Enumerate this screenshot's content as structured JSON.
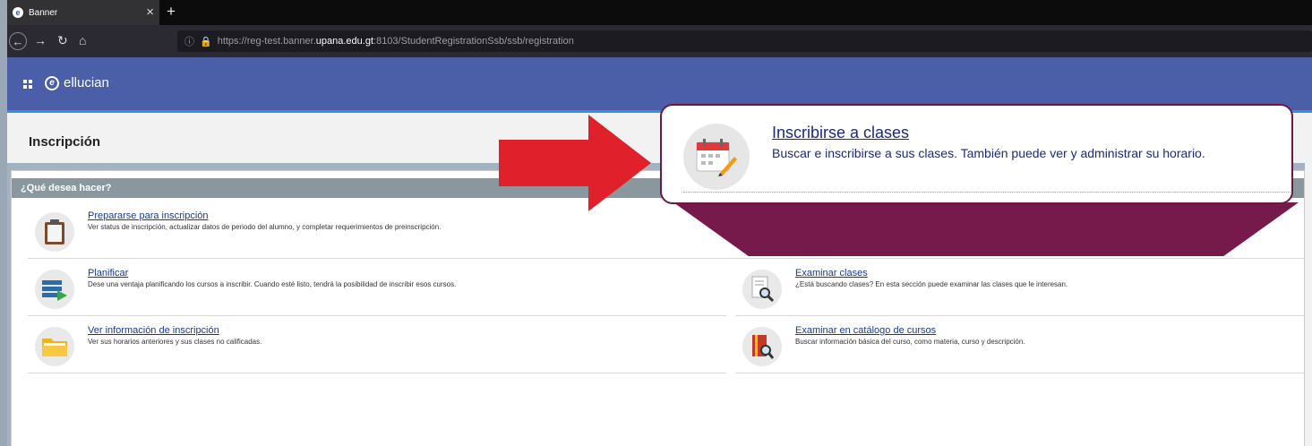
{
  "browser": {
    "tab_title": "Banner",
    "tab_logo": "ellucian-icon",
    "url_prefix": "https://reg-test.banner.",
    "url_domain": "upana.edu.gt",
    "url_suffix": ":8103/StudentRegistrationSsb/ssb/registration"
  },
  "app": {
    "brand": "ellucian",
    "page_title": "Inscripción"
  },
  "panel": {
    "header": "¿Qué desea hacer?",
    "items": [
      {
        "title": "Prepararse para inscripción",
        "desc": "Ver status de inscripción, actualizar datos de periodo del alumno, y completar requerimientos de preinscripción.",
        "icon": "clipboard-icon"
      },
      {
        "title": "Planificar",
        "desc": "Dese una ventaja planificando los cursos a inscribir. Cuando esté listo, tendrá la posibilidad de inscribir esos cursos.",
        "icon": "plan-list-icon"
      },
      {
        "title": "Ver información de inscripción",
        "desc": "Ver sus horarios anteriores y sus clases no calificadas.",
        "icon": "folder-icon"
      },
      {
        "title": "Examinar clases",
        "desc": "¿Está buscando clases? En esta sección puede examinar las clases que le interesan.",
        "icon": "document-search-icon"
      },
      {
        "title": "Examinar en catálogo de cursos",
        "desc": "Buscar información básica del curso, como materia, curso y descripción.",
        "icon": "book-search-icon"
      }
    ]
  },
  "callout": {
    "title": "Inscribirse a clases",
    "desc": "Buscar e inscribirse a sus clases. También puede ver y administrar su horario.",
    "icon": "calendar-edit-icon"
  },
  "colors": {
    "header_blue": "#4b5ea8",
    "callout_border": "#6b1a47",
    "arrow_red": "#e0202a"
  }
}
